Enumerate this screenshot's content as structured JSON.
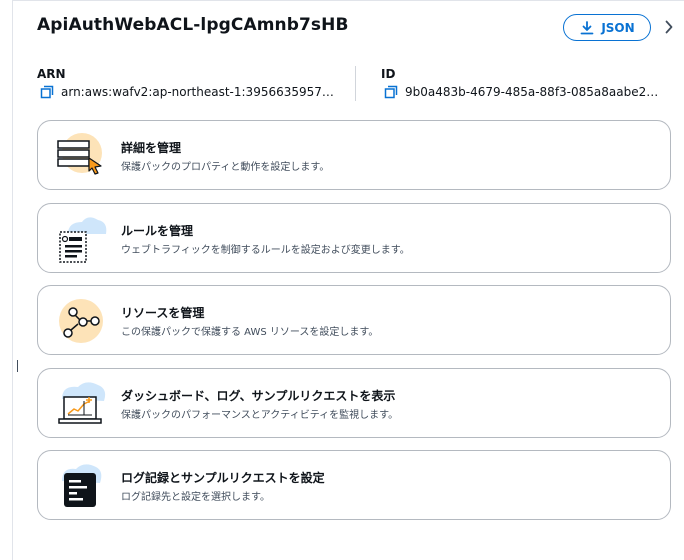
{
  "header": {
    "title": "ApiAuthWebACL-lpgCAmnb7sHB",
    "json_button_label": "JSON"
  },
  "meta": {
    "arn_label": "ARN",
    "arn_value": "arn:aws:wafv2:ap-northeast-1:3956635957…",
    "id_label": "ID",
    "id_value": "9b0a483b-4679-485a-88f3-085a8aabe2…"
  },
  "cards": [
    {
      "title": "詳細を管理",
      "description": "保護パックのプロパティと動作を設定します。",
      "icon": "details-list-icon"
    },
    {
      "title": "ルールを管理",
      "description": "ウェブトラフィックを制御するルールを設定および変更します。",
      "icon": "rules-document-icon"
    },
    {
      "title": "リソースを管理",
      "description": "この保護パックで保護する AWS リソースを設定します。",
      "icon": "resources-network-icon"
    },
    {
      "title": "ダッシュボード、ログ、サンプルリクエストを表示",
      "description": "保護パックのパフォーマンスとアクティビティを監視します。",
      "icon": "dashboard-laptop-icon"
    },
    {
      "title": "ログ記録とサンプルリクエストを設定",
      "description": "ログ記録先と設定を選択します。",
      "icon": "logging-terminal-icon"
    }
  ],
  "colors": {
    "accent": "#0972d3",
    "icon_orange_bg": "#fde3b8",
    "icon_blue_bg": "#cfe6fb"
  }
}
